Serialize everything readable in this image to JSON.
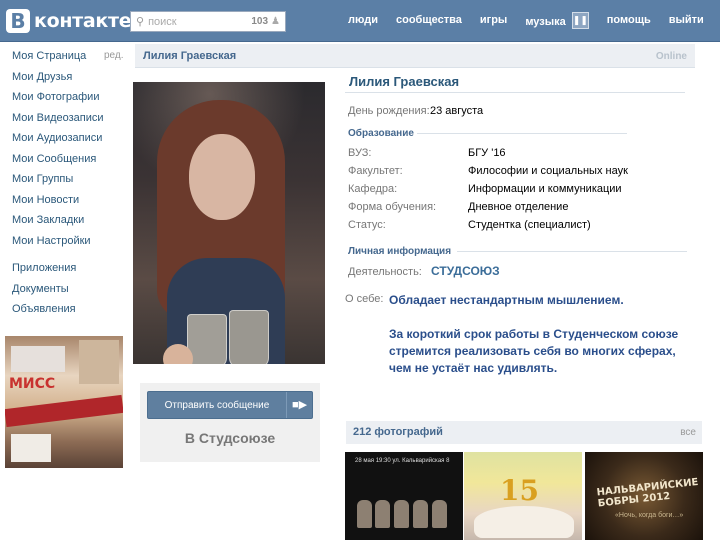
{
  "header": {
    "logo_letter": "B",
    "logo_text": "контакте",
    "search": {
      "placeholder": "поиск",
      "count": "103"
    },
    "nav": [
      "люди",
      "сообщества",
      "игры",
      "музыка",
      "помощь",
      "выйти"
    ]
  },
  "sidebar": {
    "edit_label": "ред.",
    "items": [
      "Моя Страница",
      "Мои Друзья",
      "Мои Фотографии",
      "Мои Видеозаписи",
      "Мои Аудиозаписи",
      "Мои Сообщения",
      "Мои Группы",
      "Мои Новости",
      "Мои Закладки",
      "Мои Настройки"
    ],
    "extra_items": [
      "Приложения",
      "Документы",
      "Объявления"
    ],
    "ad_text": "МИСС"
  },
  "profile": {
    "header_name": "Лилия Граевская",
    "status": "Online",
    "name": "Лилия Граевская",
    "birthday_label": "День рождения:",
    "birthday_value": "23 августа",
    "education_title": "Образование",
    "education": [
      {
        "label": "ВУЗ:",
        "value": "БГУ '16"
      },
      {
        "label": "Факультет:",
        "value": "Философии и социальных наук"
      },
      {
        "label": "Кафедра:",
        "value": "Информации и коммуникации"
      },
      {
        "label": "Форма обучения:",
        "value": "Дневное отделение"
      },
      {
        "label": "Статус:",
        "value": "Студентка (специалист)"
      }
    ],
    "personal_title": "Личная информация",
    "activity_label": "Деятельность:",
    "activity_value": "СТУДСОЮЗ",
    "about_label": "О себе:",
    "about_p1": "Обладает нестандартным мышлением.",
    "about_p2": "За короткий срок работы в Студенческом союзе стремится реализовать себя во многих сферах, чем не устаёт нас удивлять.",
    "send_message": "Отправить сообщение",
    "tagline": "В Студсоюзе",
    "photos_title": "212 фотографий",
    "photos_all": "все"
  },
  "thumbnails": {
    "t1_header": "28 мая 19:30  ул. Кальварийская 8",
    "t2_number": "15",
    "t3_title": "НАЛЬВАРИЙСКИЕ БОБРЫ 2012",
    "t3_sub": "«Ночь, когда боги…»"
  },
  "colors": {
    "topbar": "#5b7fa6",
    "link": "#2b587a",
    "section": "#45688e",
    "about_text": "#2a4e8b"
  }
}
